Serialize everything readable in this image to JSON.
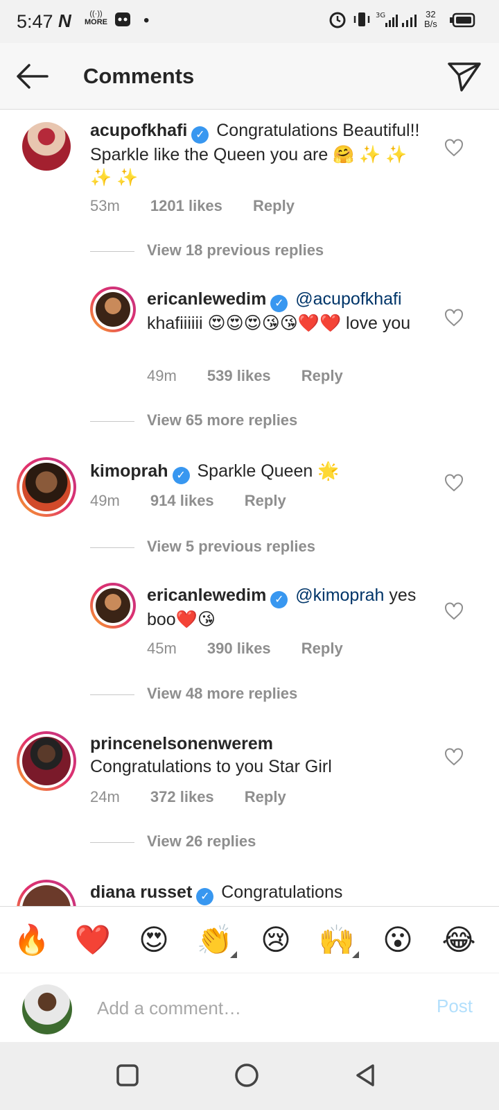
{
  "status_bar": {
    "time": "5:47",
    "net_speed_value": "32",
    "net_speed_unit": "B/s",
    "more_label": "MORE"
  },
  "header": {
    "title": "Comments"
  },
  "comments": [
    {
      "username": "acupofkhafi",
      "verified": true,
      "text": "Congratulations Beautiful!! Sparkle like the Queen you are 🤗 ✨ ✨ ✨ ✨",
      "time": "53m",
      "likes": "1201 likes",
      "reply": "Reply"
    },
    {
      "view_label": "View 18 previous replies"
    },
    {
      "username": "ericanlewedim",
      "verified": true,
      "mention": "@acupofkhafi",
      "text": "khafiiiiii 😍😍😍😘😘❤️❤️ love you",
      "time": "49m",
      "likes": "539 likes",
      "reply": "Reply"
    },
    {
      "view_label": "View 65 more replies"
    },
    {
      "username": "kimoprah",
      "verified": true,
      "text": "Sparkle Queen 🌟",
      "time": "49m",
      "likes": "914 likes",
      "reply": "Reply"
    },
    {
      "view_label": "View 5 previous replies"
    },
    {
      "username": "ericanlewedim",
      "verified": true,
      "mention": "@kimoprah",
      "text": "yes boo❤️😘",
      "time": "45m",
      "likes": "390 likes",
      "reply": "Reply"
    },
    {
      "view_label": "View 48 more replies"
    },
    {
      "username": "princenelsonenwerem",
      "verified": false,
      "text": "Congratulations to you Star Girl",
      "time": "24m",
      "likes": "372 likes",
      "reply": "Reply"
    },
    {
      "view_label": "View 26 replies"
    },
    {
      "username": "diana russet",
      "text": "Congratulations"
    }
  ],
  "emoji_bar": [
    "🔥",
    "❤️",
    "😍",
    "👏",
    "😢",
    "🙌",
    "😮",
    "😂"
  ],
  "input": {
    "placeholder": "Add a comment…",
    "post_label": "Post"
  },
  "colors": {
    "link": "#003569",
    "verified": "#3897f0",
    "muted": "#8e8e8e",
    "post_disabled": "#b2dffc"
  }
}
